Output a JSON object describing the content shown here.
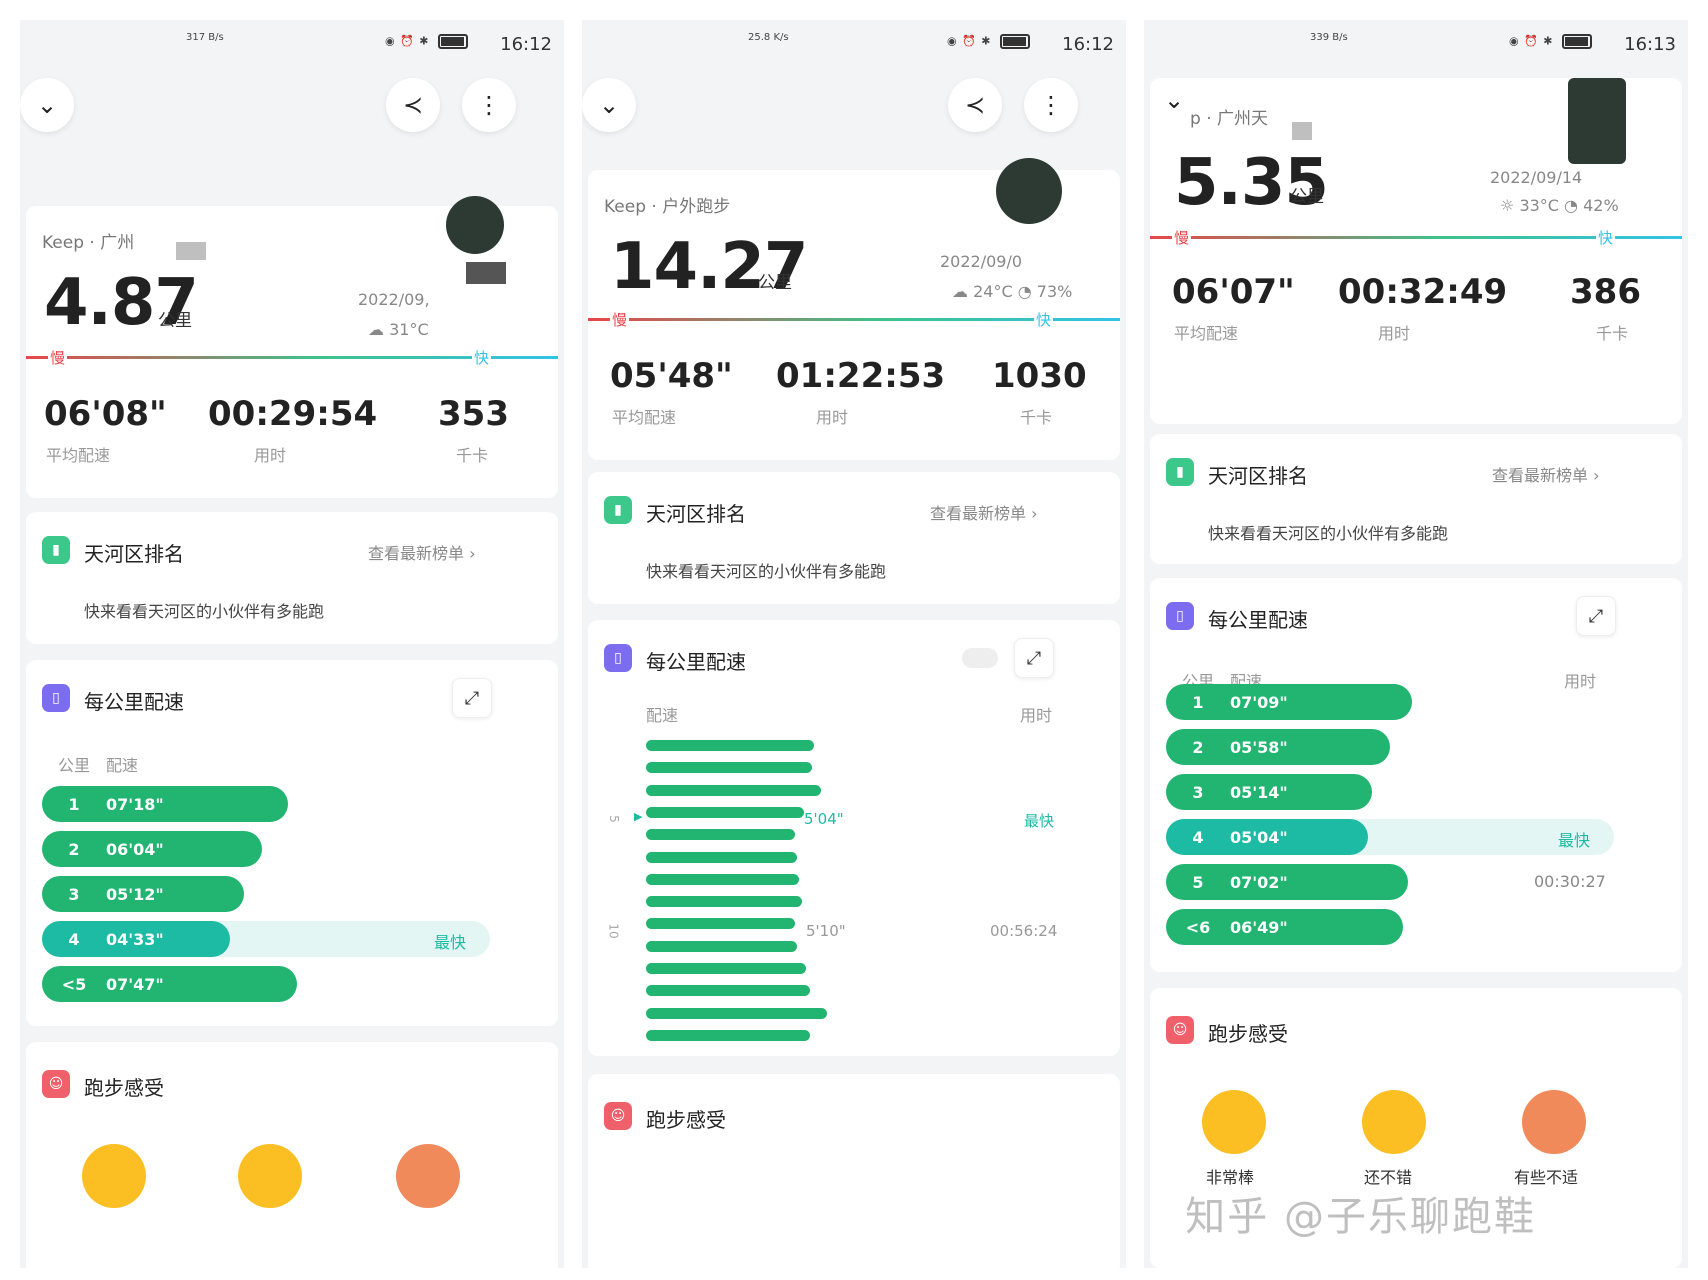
{
  "watermark": "知乎 @子乐聊跑鞋",
  "icons": {
    "back": "chevron-down-icon",
    "share": "share-icon",
    "more": "more-vertical-icon",
    "rank": "bar-chart-icon",
    "pace": "pace-icon",
    "feel": "smile-icon",
    "expand": "expand-icon"
  },
  "colors": {
    "bar": "#22b571",
    "fast": "#1dbba3",
    "slow": "#e9454a"
  },
  "panels": [
    {
      "status": {
        "net": "317 B/s",
        "time": "16:12"
      },
      "source": "Keep · 广州",
      "distance": "4.87",
      "distance_unit": "公里",
      "date": "2022/09,",
      "weather": "31°C",
      "slow_label": "慢",
      "fast_label": "快",
      "stats": [
        {
          "value": "06'08\"",
          "label": "平均配速"
        },
        {
          "value": "00:29:54",
          "label": "用时"
        },
        {
          "value": "353",
          "label": "千卡"
        }
      ],
      "ranking": {
        "title": "天河区排名",
        "link": "查看最新榜单 ›",
        "desc": "快来看看天河区的小伙伴有多能跑"
      },
      "splits_title": "每公里配速",
      "splits_headers": [
        "公里",
        "配速"
      ],
      "splits": [
        {
          "km": "1",
          "pace": "07'18\"",
          "fill": 0.55
        },
        {
          "km": "2",
          "pace": "06'04\"",
          "fill": 0.49
        },
        {
          "km": "3",
          "pace": "05'12\"",
          "fill": 0.45
        },
        {
          "km": "4",
          "pace": "04'33\"",
          "fill": 0.42,
          "fastest": true
        },
        {
          "km": "<5",
          "pace": "07'47\"",
          "fill": 0.57
        }
      ],
      "fastest_tag": "最快",
      "feel_title": "跑步感受"
    },
    {
      "status": {
        "net": "25.8 K/s",
        "time": "16:12"
      },
      "source": "Keep · 户外跑步",
      "distance": "14.27",
      "distance_unit": "公里",
      "date": "2022/09/0",
      "weather_temp": "24°C",
      "weather_hum": "73%",
      "slow_label": "慢",
      "fast_label": "快",
      "stats": [
        {
          "value": "05'48\"",
          "label": "平均配速"
        },
        {
          "value": "01:22:53",
          "label": "用时"
        },
        {
          "value": "1030",
          "label": "千卡"
        }
      ],
      "ranking": {
        "title": "天河区排名",
        "link": "查看最新榜单 ›",
        "desc": "快来看看天河区的小伙伴有多能跑"
      },
      "splits_title": "每公里配速",
      "col_pace": "配速",
      "col_time": "用时",
      "bars": [
        0.78,
        0.77,
        0.81,
        0.73,
        0.69,
        0.7,
        0.71,
        0.72,
        0.69,
        0.7,
        0.74,
        0.76,
        0.84,
        0.76
      ],
      "marker5": {
        "tick": "5",
        "pace": "5'04\"",
        "tag": "最快"
      },
      "marker10": {
        "tick": "10",
        "pace": "5'10\"",
        "time": "00:56:24"
      },
      "feel_title": "跑步感受"
    },
    {
      "status": {
        "net": "339 B/s",
        "time": "16:13"
      },
      "source": "p · 广州天",
      "distance": "5.35",
      "distance_unit": "公里",
      "date": "2022/09/14 ",
      "weather_temp": "33°C",
      "weather_hum": "42%",
      "slow_label": "慢",
      "fast_label": "快",
      "stats": [
        {
          "value": "06'07\"",
          "label": "平均配速"
        },
        {
          "value": "00:32:49",
          "label": "用时"
        },
        {
          "value": "386",
          "label": "千卡"
        }
      ],
      "ranking": {
        "title": "天河区排名",
        "link": "查看最新榜单 ›",
        "desc": "快来看看天河区的小伙伴有多能跑"
      },
      "splits_title": "每公里配速",
      "splits_headers": [
        "公里",
        "配速",
        "用时"
      ],
      "splits": [
        {
          "km": "1",
          "pace": "07'09\"",
          "fill": 0.55
        },
        {
          "km": "2",
          "pace": "05'58\"",
          "fill": 0.5
        },
        {
          "km": "3",
          "pace": "05'14\"",
          "fill": 0.46
        },
        {
          "km": "4",
          "pace": "05'04\"",
          "fill": 0.45,
          "fastest": true
        },
        {
          "km": "5",
          "pace": "07'02\"",
          "fill": 0.54,
          "time": "00:30:27"
        },
        {
          "km": "<6",
          "pace": "06'49\"",
          "fill": 0.53
        }
      ],
      "fastest_tag": "最快",
      "feel_title": "跑步感受",
      "feelings": [
        "非常棒",
        "还不错",
        "有些不适"
      ]
    }
  ]
}
